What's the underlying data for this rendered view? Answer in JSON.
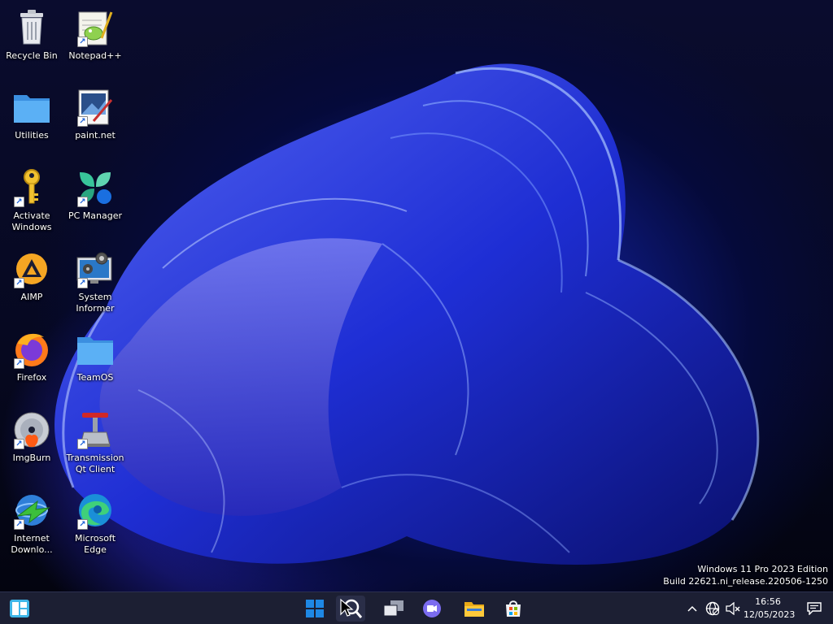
{
  "desktop": {
    "icons": [
      {
        "label": "Recycle Bin",
        "icon": "recycle-bin-icon",
        "shortcut": false
      },
      {
        "label": "Notepad++",
        "icon": "notepad-plus-plus-icon",
        "shortcut": true
      },
      {
        "label": "Utilities",
        "icon": "folder-icon",
        "shortcut": false
      },
      {
        "label": "paint.net",
        "icon": "paint-net-icon",
        "shortcut": true
      },
      {
        "label": "Activate Windows",
        "icon": "key-icon",
        "shortcut": true
      },
      {
        "label": "PC Manager",
        "icon": "pc-manager-icon",
        "shortcut": true
      },
      {
        "label": "AIMP",
        "icon": "aimp-icon",
        "shortcut": true
      },
      {
        "label": "System Informer",
        "icon": "system-informer-icon",
        "shortcut": true
      },
      {
        "label": "Firefox",
        "icon": "firefox-icon",
        "shortcut": true
      },
      {
        "label": "TeamOS",
        "icon": "folder-icon",
        "shortcut": false
      },
      {
        "label": "ImgBurn",
        "icon": "imgburn-icon",
        "shortcut": true
      },
      {
        "label": "Transmission Qt Client",
        "icon": "transmission-icon",
        "shortcut": true
      },
      {
        "label": "Internet Downlo...",
        "icon": "internet-download-manager-icon",
        "shortcut": true
      },
      {
        "label": "Microsoft Edge",
        "icon": "edge-icon",
        "shortcut": true
      }
    ]
  },
  "watermark": {
    "line1": "Windows 11 Pro 2023 Edition",
    "line2": "Build 22621.ni_release.220506-1250"
  },
  "taskbar": {
    "left_widget": "widgets-icon",
    "center": [
      "start-icon",
      "search-icon",
      "task-view-icon",
      "chat-icon",
      "file-explorer-icon",
      "microsoft-store-icon"
    ],
    "tray": [
      "chevron-up-icon",
      "network-icon",
      "volume-muted-icon"
    ],
    "clock_time": "16:56",
    "clock_date": "12/05/2023",
    "notification": "notification-icon"
  },
  "colors": {
    "taskbar": "#1c1f33",
    "accent": "#1a5fd6",
    "folder": "#4aa3f0"
  }
}
